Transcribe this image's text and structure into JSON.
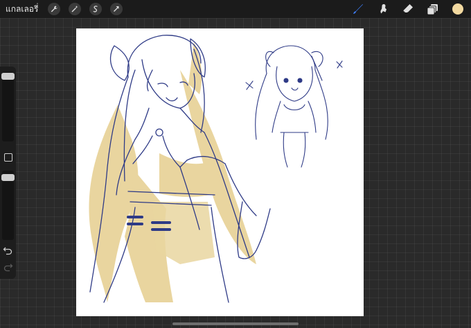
{
  "topbar": {
    "gallery_label": "แกลเลอรี่",
    "left_tools": [
      "wrench-icon",
      "magic-wand-icon",
      "selection-icon",
      "transform-arrow-icon"
    ],
    "right_tools": [
      "brush-icon",
      "smudge-icon",
      "eraser-icon",
      "layers-icon"
    ],
    "current_color": "#f2d9a0",
    "active_tool": "brush-icon",
    "accent_color": "#3d7bf2"
  },
  "sidebar": {
    "controls": [
      "brush-size-slider",
      "modify-button",
      "brush-opacity-slider",
      "undo-icon",
      "redo-icon"
    ]
  },
  "canvas": {
    "background": "#ffffff",
    "content": "sketch-artwork",
    "colors": {
      "lineart": "#2e3a86",
      "fill": "#e8d39a"
    }
  }
}
